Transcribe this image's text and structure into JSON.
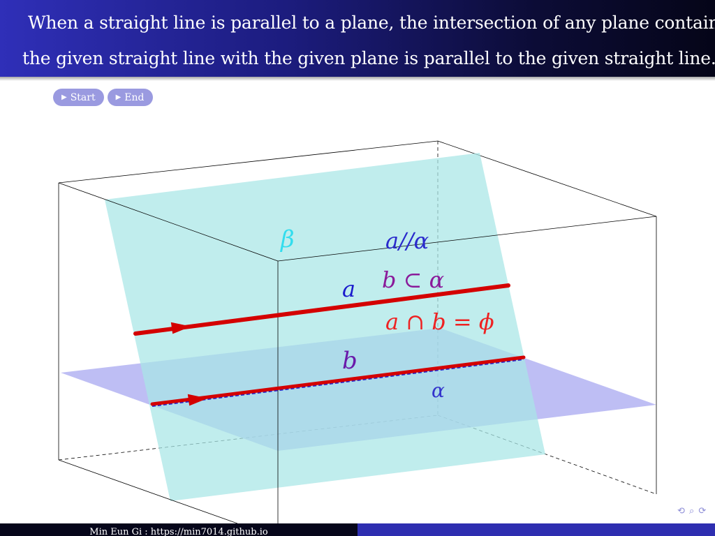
{
  "header": {
    "line1": "When a straight line is parallel to a plane, the intersection of any plane containing",
    "line2": "the given straight line with the given plane is parallel to the given straight line."
  },
  "nav": {
    "start_label": "Start",
    "end_label": "End"
  },
  "diagram": {
    "label_beta": "β",
    "label_alpha": "α",
    "label_a": "a",
    "label_b": "b",
    "relation_parallel": "a//α",
    "relation_subset": "b ⊂ α",
    "relation_intersection": "a ∩ b = ϕ",
    "colors": {
      "plane_beta": "#a8e6e6",
      "plane_alpha": "#a8a8f0",
      "lines": "#d40000",
      "label_beta": "#33ddee",
      "label_alpha": "#3333cc",
      "label_a": "#1a1acc",
      "relation_parallel": "#2a2acc",
      "relation_subset": "#8a1a9a",
      "relation_intersection": "#ee2222"
    }
  },
  "footer": {
    "author": "Min Eun Gi : https://min7014.github.io"
  },
  "beamer_nav_icons": "⟲ ⌕ ⟳"
}
